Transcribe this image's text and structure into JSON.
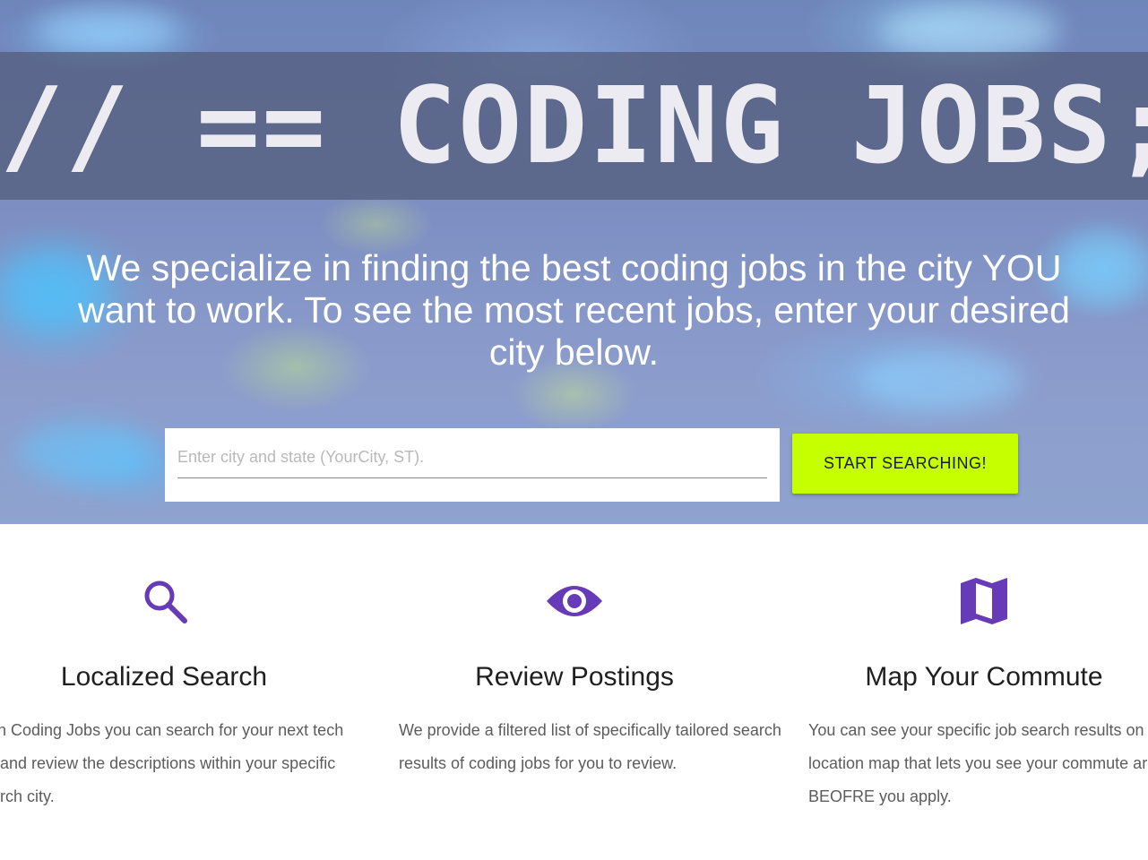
{
  "hero": {
    "title": "// == CODING JOBS;",
    "tagline": "We specialize in finding the best coding jobs in the city YOU want to work. To see the most recent jobs, enter your desired city below.",
    "search": {
      "placeholder": "Enter city and state (YourCity, ST).",
      "value": "",
      "button_label": "START SEARCHING!"
    }
  },
  "colors": {
    "accent_button": "#c6ff00",
    "icon_purple": "#673ab7"
  },
  "features": [
    {
      "icon": "search-icon",
      "title": "Localized Search",
      "text": "With Coding Jobs you can search for your next tech job and review the descriptions within your specific search city."
    },
    {
      "icon": "eye-icon",
      "title": "Review Postings",
      "text": "We provide a filtered list of specifically tailored search results of coding jobs for you to review."
    },
    {
      "icon": "map-icon",
      "title": "Map Your Commute",
      "text": "You can see your specific job search results on a location map that lets you see your commute area BEOFRE you apply."
    }
  ]
}
